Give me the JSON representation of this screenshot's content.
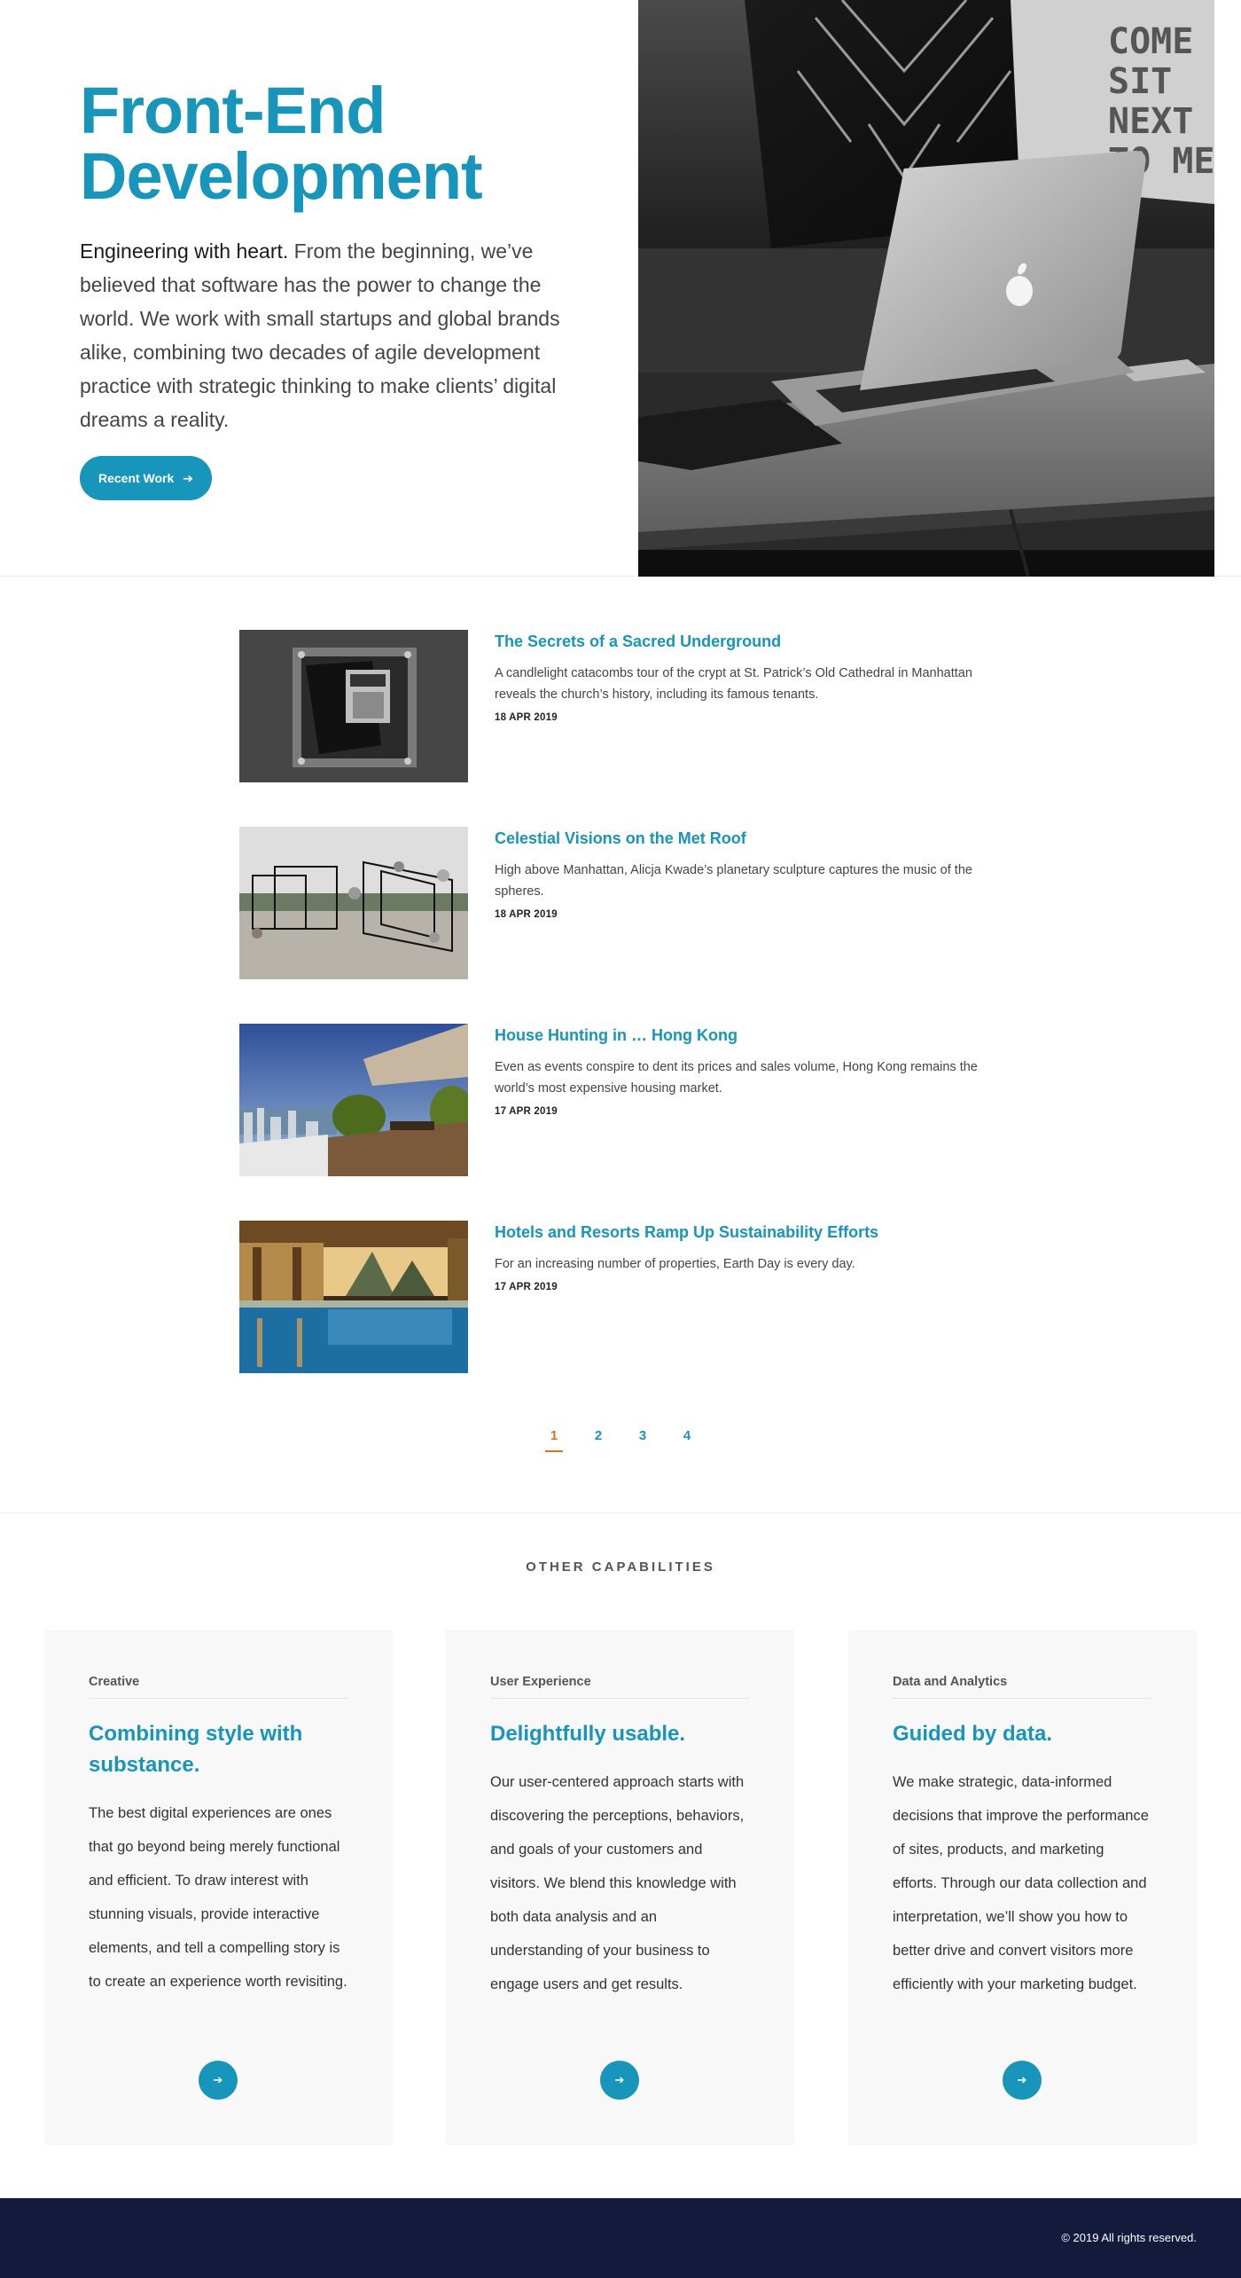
{
  "hero": {
    "title_line1": "Front-End",
    "title_line2": "Development",
    "lead": "Engineering with heart.",
    "body": " From the beginning, we’ve believed that software has the power to change the world. We work with small startups and global brands alike, combining two decades of agile development practice with strategic thinking to make clients’ digital dreams a reality.",
    "button_label": "Recent Work",
    "button_icon": "arrow-right-icon",
    "photo_text": "COME SIT NEXT TO ME"
  },
  "articles": [
    {
      "title": "The Secrets of a Sacred Underground",
      "description": "A candlelight catacombs tour of the crypt at St. Patrick’s Old Cathedral in Manhattan reveals the church’s history, including its famous tenants.",
      "date": "18 APR 2019"
    },
    {
      "title": "Celestial Visions on the Met Roof",
      "description": "High above Manhattan, Alicja Kwade’s planetary sculpture captures the music of the spheres.",
      "date": "18 APR 2019"
    },
    {
      "title": "House Hunting in … Hong Kong",
      "description": "Even as events conspire to dent its prices and sales volume, Hong Kong remains the world’s most expensive housing market.",
      "date": "17 APR 2019"
    },
    {
      "title": "Hotels and Resorts Ramp Up Sustainability Efforts",
      "description": "For an increasing number of properties, Earth Day is every day.",
      "date": "17 APR 2019"
    }
  ],
  "pagination": {
    "pages": [
      "1",
      "2",
      "3",
      "4"
    ],
    "current": "1"
  },
  "capabilities": {
    "heading": "OTHER CAPABILITIES",
    "cards": [
      {
        "label": "Creative",
        "title": "Combining style with substance.",
        "body": "The best digital experiences are ones that go beyond being merely functional and efficient. To draw interest with stunning visuals, provide interactive elements, and tell a compelling story is to create an experience worth revisiting."
      },
      {
        "label": "User Experience",
        "title": "Delightfully usable.",
        "body": "Our user-centered approach starts with discovering the perceptions, behaviors, and goals of your customers and visitors. We blend this knowledge with both data analysis and an understanding of your business to engage users and get results."
      },
      {
        "label": "Data and Analytics",
        "title": "Guided by data.",
        "body": "We make strategic, data-informed decisions that improve the performance of sites, products, and marketing efforts. Through our data collection and interpretation, we’ll show you how to better drive and convert visitors more efficiently with your marketing budget."
      }
    ]
  },
  "footer": {
    "copyright": "© 2019 All rights reserved."
  },
  "colors": {
    "accent": "#1795bb",
    "active_page": "#e2701d",
    "footer_bg": "#141a3b",
    "card_bg": "#f8f8f8"
  }
}
